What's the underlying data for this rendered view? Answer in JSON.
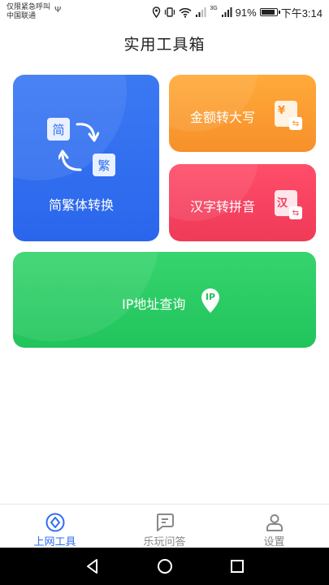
{
  "status_bar": {
    "line1": "仅限紧急呼叫",
    "line2": "中国联通",
    "network": "3G",
    "battery": "91%",
    "time": "下午3:14"
  },
  "page": {
    "title": "实用工具箱"
  },
  "tools": {
    "jianfan": {
      "label": "简繁体转换",
      "box_a": "简",
      "box_b": "繁"
    },
    "jine": {
      "label": "金额转大写",
      "badge": "¥"
    },
    "pinyin": {
      "label": "汉字转拼音",
      "badge": "汉"
    },
    "ip": {
      "label": "IP地址查询",
      "badge": "IP"
    }
  },
  "bottom_nav": {
    "items": [
      {
        "label": "上网工具"
      },
      {
        "label": "乐玩问答"
      },
      {
        "label": "设置"
      }
    ]
  },
  "colors": {
    "blue": "#2f6df0",
    "orange": "#f7902a",
    "red": "#ef3a58",
    "green": "#21c45c"
  }
}
